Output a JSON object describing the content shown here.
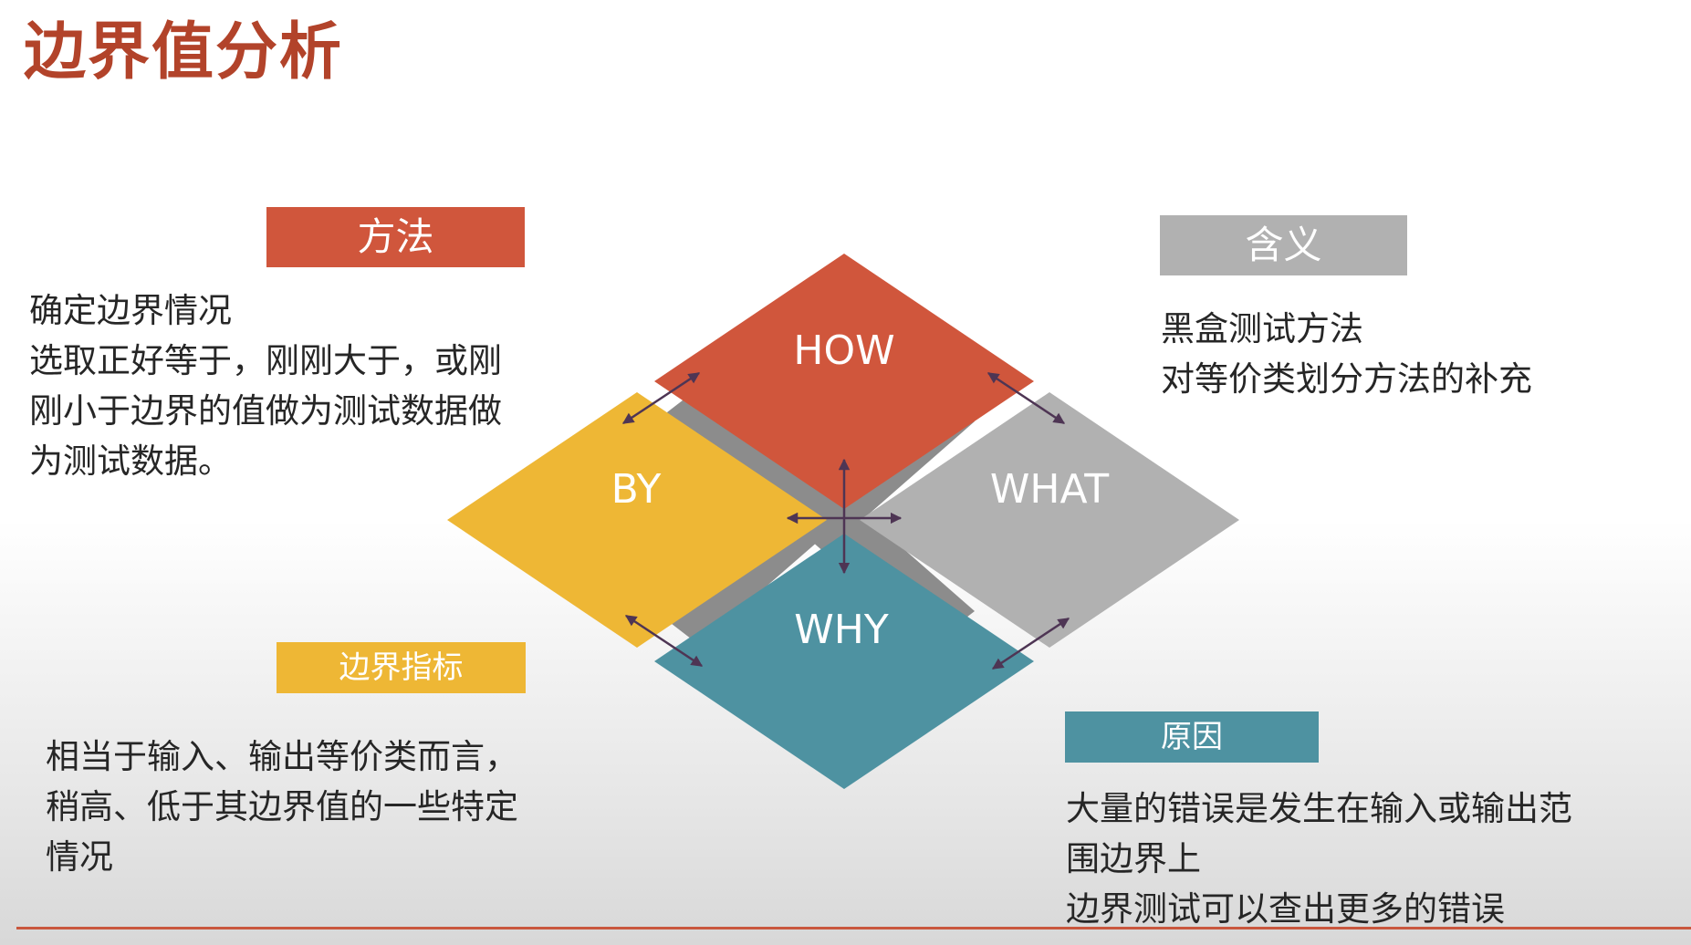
{
  "page": {
    "title": "边界值分析"
  },
  "colors": {
    "title": "#b2432a",
    "how": "#d0563c",
    "by": "#eeb735",
    "what": "#b1b1b1",
    "why": "#4e92a1",
    "connector": "#8c8c8c",
    "arrow": "#4e3554",
    "rule": "#c9573e"
  },
  "diagram": {
    "how": "HOW",
    "by": "BY",
    "what": "WHAT",
    "why": "WHY"
  },
  "method": {
    "label": "方法",
    "lines": [
      "确定边界情况",
      "选取正好等于，刚刚大于，或刚",
      "刚小于边界的值做为测试数据做",
      "为测试数据。"
    ]
  },
  "meaning": {
    "label": "含义",
    "lines": [
      "黑盒测试方法",
      "对等价类划分方法的补充"
    ]
  },
  "indicator": {
    "label": "边界指标",
    "lines": [
      "相当于输入、输出等价类而言，",
      "稍高、低于其边界值的一些特定",
      "情况"
    ]
  },
  "reason": {
    "label": "原因",
    "lines": [
      "大量的错误是发生在输入或输出范",
      "围边界上",
      "边界测试可以查出更多的错误"
    ]
  }
}
